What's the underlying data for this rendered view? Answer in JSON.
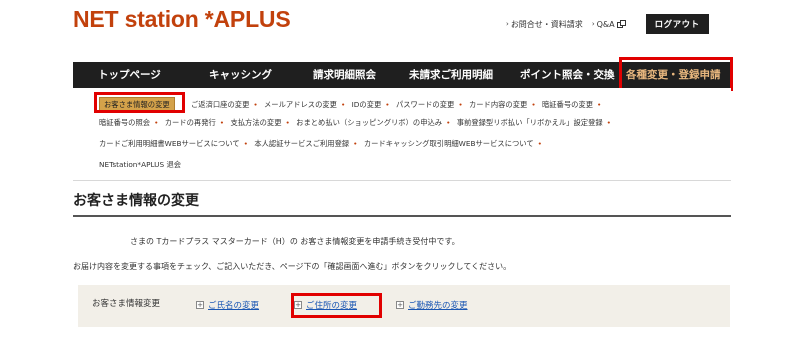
{
  "header": {
    "logo": "NET station *APLUS",
    "links": [
      {
        "label": "お問合せ・資料請求"
      },
      {
        "label": "Q&A"
      }
    ],
    "logout_label": "ログアウト"
  },
  "global_nav": {
    "items": [
      {
        "label": "トップページ"
      },
      {
        "label": "キャッシング"
      },
      {
        "label": "請求明細照会"
      },
      {
        "label": "未請求ご利用明細"
      },
      {
        "label": "ポイント照会・交換"
      },
      {
        "label": "各種変更・登録申請"
      }
    ]
  },
  "sub_nav": {
    "current": "お客さま情報の変更",
    "row1": [
      "ご返済口座の変更",
      "メールアドレスの変更",
      "IDの変更",
      "パスワードの変更",
      "カード内容の変更",
      "暗証番号の変更"
    ],
    "row2": [
      "暗証番号の照会",
      "カードの再発行",
      "支払方法の変更",
      "おまとめ払い（ショッピングリボ）の申込み",
      "事前登録型リボ払い「リボかえル」設定登録"
    ],
    "row3": [
      "カードご利用明細書WEBサービスについて",
      "本人認証サービスご利用登録",
      "カードキャッシング取引明細WEBサービスについて"
    ],
    "row4": [
      "NETstation*APLUS 退会"
    ]
  },
  "page": {
    "title": "お客さま情報の変更",
    "status_message": "さまの Tカードプラス マスターカード（H）の お客さま情報変更を申請手続き受付中です。",
    "instruction": "お届け内容を変更する事項をチェック、ご記入いただき、ページ下の「確認画面へ進む」ボタンをクリックしてください。"
  },
  "form": {
    "label": "お客さま情報変更",
    "options": [
      {
        "label": "ご氏名の変更"
      },
      {
        "label": "ご住所の変更"
      },
      {
        "label": "ご勤務先の変更"
      }
    ]
  },
  "colors": {
    "logo": "#c2410c",
    "nav_bg": "#1f1f1f",
    "nav_active": "#e8b77e",
    "highlight_box": "#e10000",
    "sub_current_bg": "#d4a24a",
    "link": "#1a56b3",
    "form_bg": "#f2efe8"
  },
  "icons": {
    "link_arrow": "chevron-right-icon",
    "external": "external-window-icon",
    "checkbox": "checkbox-icon"
  }
}
